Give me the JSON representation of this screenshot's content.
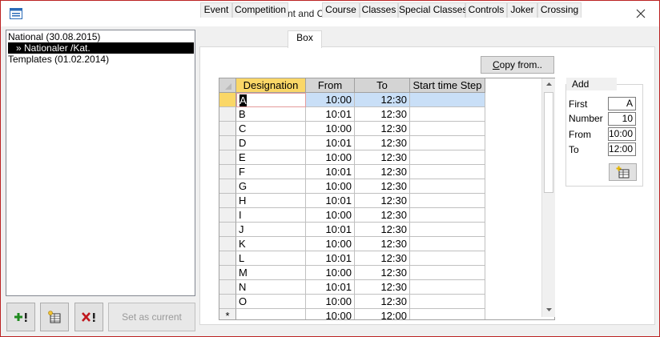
{
  "window": {
    "title": "Event and Course definition"
  },
  "tree": {
    "items": [
      {
        "label": "National (30.08.2015)",
        "selected": false
      },
      {
        "label": "» Nationaler /Kat.",
        "selected": true
      },
      {
        "label": "Templates (01.02.2014)",
        "selected": false
      }
    ]
  },
  "left_buttons": {
    "add_icon": "plus-exclamation-icon",
    "copy_icon": "table-copy-icon",
    "delete_icon": "x-exclamation-icon",
    "set_current_label": "Set as current"
  },
  "tabs": [
    {
      "label": "Event",
      "active": false
    },
    {
      "label": "Competition",
      "active": false
    },
    {
      "label": "Box",
      "active": true
    },
    {
      "label": "Course",
      "active": false
    },
    {
      "label": "Classes",
      "active": false
    },
    {
      "label": "Special Classes",
      "active": false
    },
    {
      "label": "Controls",
      "active": false
    },
    {
      "label": "Joker",
      "active": false
    },
    {
      "label": "Crossing",
      "active": false
    }
  ],
  "copy_from_label": "Copy from..",
  "grid": {
    "columns": [
      "Designation",
      "From",
      "To",
      "Start time Step"
    ],
    "rows": [
      {
        "d": "A",
        "f": "10:00",
        "t": "12:30",
        "s": ""
      },
      {
        "d": "B",
        "f": "10:01",
        "t": "12:30",
        "s": ""
      },
      {
        "d": "C",
        "f": "10:00",
        "t": "12:30",
        "s": ""
      },
      {
        "d": "D",
        "f": "10:01",
        "t": "12:30",
        "s": ""
      },
      {
        "d": "E",
        "f": "10:00",
        "t": "12:30",
        "s": ""
      },
      {
        "d": "F",
        "f": "10:01",
        "t": "12:30",
        "s": ""
      },
      {
        "d": "G",
        "f": "10:00",
        "t": "12:30",
        "s": ""
      },
      {
        "d": "H",
        "f": "10:01",
        "t": "12:30",
        "s": ""
      },
      {
        "d": "I",
        "f": "10:00",
        "t": "12:30",
        "s": ""
      },
      {
        "d": "J",
        "f": "10:01",
        "t": "12:30",
        "s": ""
      },
      {
        "d": "K",
        "f": "10:00",
        "t": "12:30",
        "s": ""
      },
      {
        "d": "L",
        "f": "10:01",
        "t": "12:30",
        "s": ""
      },
      {
        "d": "M",
        "f": "10:00",
        "t": "12:30",
        "s": ""
      },
      {
        "d": "N",
        "f": "10:01",
        "t": "12:30",
        "s": ""
      },
      {
        "d": "O",
        "f": "10:00",
        "t": "12:30",
        "s": ""
      }
    ],
    "new_row": {
      "marker": "*",
      "f": "10:00",
      "t": "12:00"
    }
  },
  "add_panel": {
    "title": "Add",
    "first_label": "First",
    "first_value": "A",
    "number_label": "Number",
    "number_value": "10",
    "from_label": "From",
    "from_value": "10:00",
    "to_label": "To",
    "to_value": "12:00",
    "add_button_icon": "add-rows-icon"
  },
  "colors": {
    "header_selected": "#fad767",
    "row_selected": "#c9dff7",
    "accent_border": "#b22222"
  }
}
